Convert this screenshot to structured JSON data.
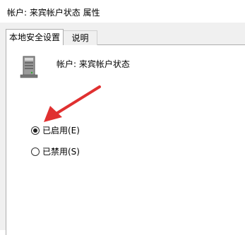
{
  "window": {
    "title": "帐户: 来宾帐户状态 属性"
  },
  "tabs": [
    {
      "label": "本地安全设置",
      "active": true
    },
    {
      "label": "说明",
      "active": false
    }
  ],
  "policy": {
    "icon": "server-icon",
    "name": "帐户: 来宾帐户状态"
  },
  "options": [
    {
      "label": "已启用(E)",
      "checked": true
    },
    {
      "label": "已禁用(S)",
      "checked": false
    }
  ],
  "colors": {
    "annotation_arrow": "#e03030",
    "tab_strip_bg": "#f0f0f0"
  }
}
